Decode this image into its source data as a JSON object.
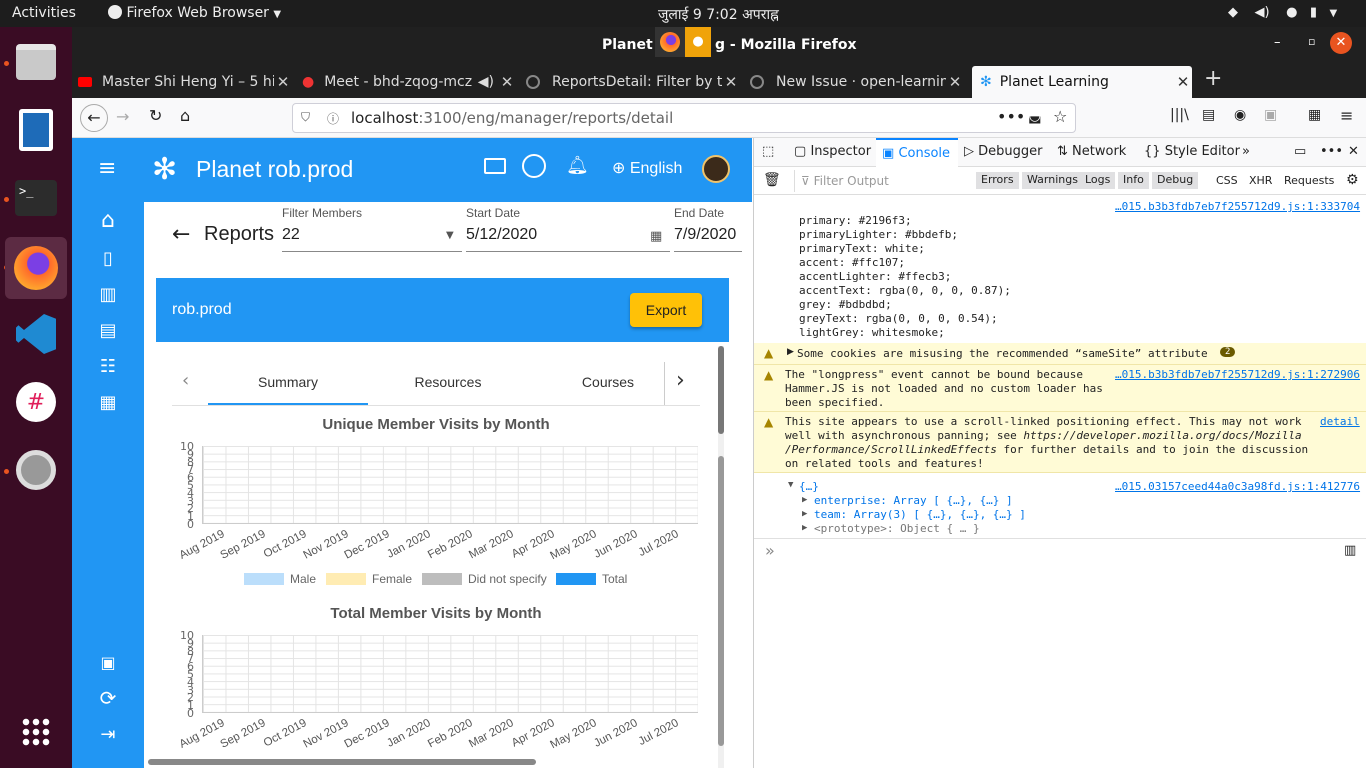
{
  "system": {
    "activities": "Activities",
    "app_menu": "Firefox Web Browser",
    "clock": "जुलाई 9   7:02 अपराह्न"
  },
  "window": {
    "title": "Planet … g - Mozilla Firefox",
    "title_left": "Planet",
    "title_right": "g - Mozilla Firefox"
  },
  "tabs": [
    {
      "label": "Master Shi Heng Yi – 5 hi"
    },
    {
      "label": "Meet - bhd-zqog-mcz"
    },
    {
      "label": "ReportsDetail: Filter by t"
    },
    {
      "label": "New Issue · open-learnin"
    },
    {
      "label": "Planet Learning"
    }
  ],
  "url": {
    "host": "localhost",
    "path": ":3100/eng/manager/reports/detail"
  },
  "app": {
    "brand": "Planet rob.prod",
    "language": "English",
    "page_title": "Reports",
    "filter_members": {
      "label": "Filter Members",
      "value": "22"
    },
    "start_date": {
      "label": "Start Date",
      "value": "5/12/2020"
    },
    "end_date": {
      "label": "End Date",
      "value": "7/9/2020"
    },
    "banner_name": "rob.prod",
    "export_label": "Export",
    "tabs": [
      "Summary",
      "Resources",
      "Courses"
    ]
  },
  "chart_data": [
    {
      "type": "bar",
      "title": "Unique Member Visits by Month",
      "categories": [
        "Aug 2019",
        "Sep 2019",
        "Oct 2019",
        "Nov 2019",
        "Dec 2019",
        "Jan 2020",
        "Feb 2020",
        "Mar 2020",
        "Apr 2020",
        "May 2020",
        "Jun 2020",
        "Jul 2020"
      ],
      "yticks": [
        "10",
        "9",
        "8",
        "7",
        "6",
        "5",
        "4",
        "3",
        "2",
        "1",
        "0"
      ],
      "ylim": [
        0,
        10
      ],
      "series": [
        {
          "name": "Male",
          "values": [
            0,
            0,
            0,
            0,
            0,
            0,
            0,
            0,
            0,
            0,
            0,
            0
          ],
          "color": "#bbdefb"
        },
        {
          "name": "Female",
          "values": [
            0,
            0,
            0,
            0,
            0,
            0,
            0,
            0,
            0,
            0,
            0,
            0
          ],
          "color": "#ffecb3"
        },
        {
          "name": "Did not specify",
          "values": [
            0,
            0,
            0,
            0,
            0,
            0,
            0,
            0,
            0,
            0,
            0,
            0
          ],
          "color": "#bdbdbd"
        },
        {
          "name": "Total",
          "values": [
            0,
            0,
            0,
            0,
            0,
            0,
            0,
            0,
            0,
            0,
            0,
            0
          ],
          "color": "#2196f3"
        }
      ],
      "grid": true,
      "legend": "bottom"
    },
    {
      "type": "bar",
      "title": "Total Member Visits by Month",
      "categories": [
        "Aug 2019",
        "Sep 2019",
        "Oct 2019",
        "Nov 2019",
        "Dec 2019",
        "Jan 2020",
        "Feb 2020",
        "Mar 2020",
        "Apr 2020",
        "May 2020",
        "Jun 2020",
        "Jul 2020"
      ],
      "yticks": [
        "10",
        "9",
        "8",
        "7",
        "6",
        "5",
        "4",
        "3",
        "2",
        "1",
        "0"
      ],
      "ylim": [
        0,
        10
      ],
      "grid": true
    }
  ],
  "devtools": {
    "tabs": [
      "Inspector",
      "Console",
      "Debugger",
      "Network",
      "Style Editor"
    ],
    "filter_placeholder": "Filter Output",
    "filters": [
      "Errors",
      "Warnings",
      "Logs",
      "Info",
      "Debug"
    ],
    "extra_filters": [
      "CSS",
      "XHR",
      "Requests"
    ],
    "src1": "…015.b3b3fdb7eb7f255712d9.js:1:333704",
    "src2": "…015.b3b3fdb7eb7f255712d9.js:1:272906",
    "src3": "…015.03157ceed44a0c3a98fd.js:1:412776",
    "palette": [
      "primary: #2196f3;",
      "primaryLighter: #bbdefb;",
      "primaryText: white;",
      "accent: #ffc107;",
      "accentLighter: #ffecb3;",
      "accentText: rgba(0, 0, 0, 0.87);",
      "grey: #bdbdbd;",
      "greyText: rgba(0, 0, 0, 0.54);",
      "lightGrey: whitesmoke;"
    ],
    "warn1": "Some cookies are misusing the recommended “sameSite” attribute",
    "warn1_count": "2",
    "warn2_l1": "The \"longpress\" event cannot be bound because",
    "warn2_l2": "Hammer.JS is not loaded and no custom loader has",
    "warn2_l3": "been specified.",
    "warn3_l1": "This site appears to use a scroll-linked positioning effect. This may not work",
    "warn3_l2_a": "well with asynchronous panning; see ",
    "warn3_l2_b": "https://developer.mozilla.org/docs/Mozilla",
    "warn3_l3_a": "/Performance/ScrollLinkedEffects",
    "warn3_l3_b": " for further details and to join the discussion",
    "warn3_l4": "on related tools and features!",
    "warn3_detail": "detail",
    "obj": "{…}",
    "enterprise": "enterprise: Array [ {…}, {…} ]",
    "team": "team: Array(3) [ {…}, {…}, {…} ]",
    "proto": "<prototype>: Object { … }",
    "prompt": "»"
  }
}
